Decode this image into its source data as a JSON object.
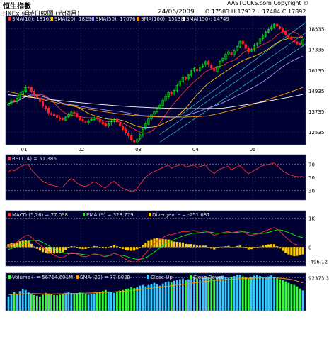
{
  "header": {
    "index_name": "恒生指數",
    "subtitle": "HKEx 延時日線圖 (六個月)",
    "date": "24/06/2009",
    "ohlc": "O:17583  H:17912  L:17484  C:17892",
    "copyright": "AASTOCKS.com Copyright ©"
  },
  "colors": {
    "background": "#000033",
    "up_candle": "#00ff00",
    "down_candle": "#ff2020",
    "sma10": "#ff3030",
    "sma20": "#ffcc00",
    "sma50": "#9999ff",
    "sma100": "#ff9900",
    "sma150": "#ffffff",
    "channel": "#33cccc",
    "rsi": "#ff3030",
    "macd": "#ff3030",
    "ema": "#00ff00",
    "divergence": "#ffcc00",
    "volume_up": "#33ccff",
    "volume_down": "#33ff33",
    "volume_sma": "#ff9900"
  },
  "chart_data": [
    {
      "type": "candlestick",
      "legend": [
        {
          "label": "SMA(10): 18162",
          "color": "#ff3030"
        },
        {
          "label": "SMA(20): 18290",
          "color": "#ffcc00"
        },
        {
          "label": "SMA(50): 17076",
          "color": "#9999ff"
        },
        {
          "label": "SMA(100): 15138",
          "color": "#ff9900"
        },
        {
          "label": "SMA(150): 14749",
          "color": "#ffffff"
        }
      ],
      "y_ticks": [
        12535,
        13735,
        14935,
        16135,
        17335,
        18535
      ],
      "ylim": [
        11800,
        19300
      ],
      "x_ticks": [
        "01",
        "02",
        "03",
        "04",
        "05",
        "06"
      ],
      "close": [
        14180,
        14350,
        14320,
        14500,
        14760,
        14900,
        15120,
        15150,
        14900,
        14700,
        14520,
        14300,
        14050,
        13900,
        13650,
        13560,
        13470,
        13380,
        13300,
        13250,
        13400,
        13560,
        13700,
        13600,
        13420,
        13250,
        13180,
        13100,
        13170,
        13280,
        13360,
        13290,
        13120,
        12990,
        12900,
        13020,
        13180,
        13280,
        13120,
        12900,
        12680,
        12500,
        12320,
        12080,
        11960,
        12100,
        12380,
        12700,
        13020,
        13300,
        13540,
        13720,
        13900,
        14100,
        14380,
        14620,
        14850,
        14720,
        14960,
        15240,
        15480,
        15700,
        15590,
        15850,
        16100,
        16230,
        16100,
        16300,
        16450,
        16620,
        16450,
        16250,
        16100,
        16350,
        16650,
        16800,
        17050,
        17200,
        17020,
        17250,
        17500,
        17800,
        17650,
        17400,
        17200,
        17300,
        17550,
        17700,
        17950,
        18150,
        18350,
        18500,
        18650,
        18800,
        18700,
        18540,
        18350,
        18200,
        18050,
        17920,
        17780,
        17650,
        17620,
        17892
      ]
    },
    {
      "type": "line",
      "legend": [
        {
          "label": "RSI (14) = 51.386",
          "color": "#ff3030"
        }
      ],
      "y_ticks": [
        30,
        50,
        70
      ],
      "ylim": [
        15,
        85
      ],
      "values": [
        58,
        62,
        60,
        63,
        66,
        68,
        70,
        69,
        62,
        57,
        53,
        48,
        44,
        42,
        39,
        38,
        37,
        36,
        35,
        35,
        40,
        45,
        48,
        45,
        41,
        38,
        37,
        36,
        38,
        41,
        43,
        41,
        38,
        35,
        34,
        38,
        42,
        44,
        40,
        36,
        33,
        31,
        30,
        28,
        29,
        33,
        39,
        45,
        50,
        54,
        57,
        59,
        61,
        63,
        65,
        67,
        69,
        64,
        66,
        68,
        69,
        70,
        66,
        67,
        68,
        69,
        65,
        67,
        68,
        69,
        63,
        59,
        56,
        60,
        63,
        64,
        66,
        67,
        62,
        64,
        66,
        68,
        64,
        59,
        56,
        58,
        61,
        63,
        66,
        68,
        69,
        70,
        71,
        72,
        68,
        64,
        60,
        57,
        55,
        53,
        52,
        51,
        51,
        51.386
      ]
    },
    {
      "type": "line+bar",
      "legend": [
        {
          "label": "MACD (5,26) = 77.098",
          "color": "#ff3030"
        },
        {
          "label": "EMA (9) = 328.779",
          "color": "#00ff00"
        },
        {
          "label": "Divergence = -251.681",
          "color": "#ffcc00"
        }
      ],
      "y_ticks": [
        "1K",
        "0",
        "-496.12"
      ],
      "ylim": [
        -650,
        1250
      ],
      "macd": [
        20,
        80,
        110,
        170,
        260,
        330,
        390,
        410,
        340,
        250,
        160,
        80,
        -10,
        -90,
        -170,
        -230,
        -280,
        -320,
        -350,
        -360,
        -310,
        -250,
        -190,
        -200,
        -240,
        -290,
        -320,
        -330,
        -300,
        -260,
        -230,
        -240,
        -270,
        -310,
        -330,
        -300,
        -250,
        -210,
        -240,
        -290,
        -350,
        -410,
        -460,
        -500,
        -520,
        -490,
        -420,
        -320,
        -210,
        -100,
        20,
        120,
        200,
        260,
        320,
        380,
        430,
        420,
        450,
        480,
        510,
        540,
        520,
        540,
        560,
        570,
        540,
        550,
        560,
        570,
        510,
        460,
        410,
        440,
        480,
        500,
        520,
        540,
        490,
        510,
        540,
        570,
        540,
        480,
        420,
        410,
        430,
        450,
        480,
        520,
        560,
        600,
        640,
        670,
        620,
        540,
        440,
        340,
        250,
        170,
        110,
        80,
        70,
        77.098
      ],
      "ema": [
        -80,
        -50,
        -20,
        20,
        60,
        110,
        160,
        210,
        230,
        230,
        220,
        200,
        160,
        110,
        50,
        -10,
        -60,
        -110,
        -150,
        -190,
        -210,
        -220,
        -220,
        -220,
        -225,
        -235,
        -250,
        -265,
        -270,
        -270,
        -265,
        -262,
        -263,
        -272,
        -283,
        -286,
        -281,
        -270,
        -265,
        -270,
        -285,
        -310,
        -340,
        -370,
        -400,
        -418,
        -418,
        -398,
        -360,
        -310,
        -240,
        -170,
        -100,
        -30,
        40,
        110,
        170,
        220,
        260,
        300,
        340,
        380,
        410,
        440,
        460,
        480,
        490,
        500,
        510,
        520,
        520,
        510,
        490,
        480,
        480,
        485,
        490,
        500,
        500,
        500,
        505,
        520,
        530,
        520,
        500,
        480,
        470,
        465,
        465,
        470,
        490,
        510,
        540,
        570,
        590,
        590,
        570,
        540,
        500,
        460,
        420,
        380,
        350,
        328.779
      ],
      "divergence": [
        100,
        130,
        130,
        150,
        200,
        220,
        230,
        200,
        110,
        20,
        -60,
        -120,
        -170,
        -200,
        -220,
        -220,
        -220,
        -210,
        -200,
        -170,
        -100,
        -30,
        30,
        20,
        -15,
        -55,
        -70,
        -65,
        -30,
        10,
        35,
        22,
        -7,
        -38,
        -47,
        -14,
        31,
        60,
        25,
        -20,
        -65,
        -100,
        -120,
        -130,
        -120,
        -72,
        -2,
        78,
        150,
        210,
        260,
        290,
        300,
        290,
        280,
        270,
        260,
        200,
        190,
        180,
        170,
        160,
        110,
        100,
        100,
        90,
        50,
        50,
        50,
        50,
        -10,
        -50,
        -80,
        -40,
        0,
        15,
        30,
        40,
        -10,
        10,
        35,
        50,
        10,
        -40,
        -80,
        -70,
        -40,
        -15,
        15,
        50,
        70,
        90,
        100,
        100,
        30,
        -50,
        -130,
        -200,
        -250,
        -290,
        -310,
        -300,
        -280,
        -251.681
      ]
    },
    {
      "type": "bar",
      "legend": [
        {
          "label": "Volume+ = 56714.691M",
          "color": "#33ff33"
        },
        {
          "label": "SMA (20) = 77.803B",
          "color": "#ff9900"
        },
        {
          "label": "Close Up",
          "color": "#33ccff"
        },
        {
          "label": "Close Down",
          "color": "#33ff33"
        }
      ],
      "y_ticks": [
        "92373.3"
      ],
      "ylim": [
        0,
        105000
      ],
      "volume": [
        40000,
        45000,
        52000,
        48000,
        55000,
        60000,
        58000,
        52000,
        47000,
        44000,
        42000,
        40000,
        45000,
        50000,
        48000,
        46000,
        44000,
        43000,
        45000,
        47000,
        50000,
        52000,
        49000,
        46000,
        48000,
        51000,
        50000,
        47000,
        45000,
        46000,
        48000,
        50000,
        52000,
        55000,
        58000,
        54000,
        52000,
        50000,
        53000,
        56000,
        58000,
        60000,
        62000,
        65000,
        63000,
        66000,
        70000,
        72000,
        68000,
        72000,
        75000,
        78000,
        74000,
        70000,
        76000,
        80000,
        82000,
        79000,
        84000,
        86000,
        88000,
        90000,
        86000,
        88000,
        92000,
        95000,
        90000,
        88000,
        92000,
        96000,
        93000,
        90000,
        88000,
        92000,
        96000,
        98000,
        94000,
        92000,
        95000,
        97000,
        99000,
        100000,
        96000,
        94000,
        92000,
        95000,
        98000,
        100000,
        97000,
        95000,
        93000,
        96000,
        99000,
        94000,
        90000,
        88000,
        85000,
        82000,
        78000,
        75000,
        72000,
        68000,
        62000,
        56714.691
      ],
      "volume_sma": [
        45000,
        45500,
        46000,
        46500,
        47000,
        47500,
        48000,
        48000,
        48000,
        47800,
        47600,
        47400,
        47200,
        47000,
        47000,
        47000,
        47100,
        47200,
        47300,
        47500,
        47800,
        48000,
        48200,
        48400,
        48600,
        48800,
        49000,
        49200,
        49500,
        49800,
        50000,
        50300,
        50600,
        51000,
        51500,
        52000,
        52400,
        52800,
        53300,
        53800,
        54300,
        55000,
        55800,
        56600,
        57400,
        58200,
        59000,
        60000,
        61000,
        62000,
        63000,
        64000,
        65000,
        66000,
        67000,
        68000,
        69000,
        70000,
        71000,
        72000,
        73000,
        74000,
        75000,
        76000,
        77000,
        78000,
        79000,
        80000,
        81000,
        82000,
        83000,
        84000,
        85000,
        85500,
        86000,
        86500,
        87000,
        87500,
        88000,
        88500,
        89000,
        89500,
        90000,
        90200,
        90400,
        90600,
        90800,
        91000,
        91200,
        91400,
        91500,
        91600,
        91700,
        91500,
        91200,
        90800,
        90200,
        89400,
        88400,
        87000,
        85200,
        82900,
        80300,
        77803
      ]
    }
  ]
}
